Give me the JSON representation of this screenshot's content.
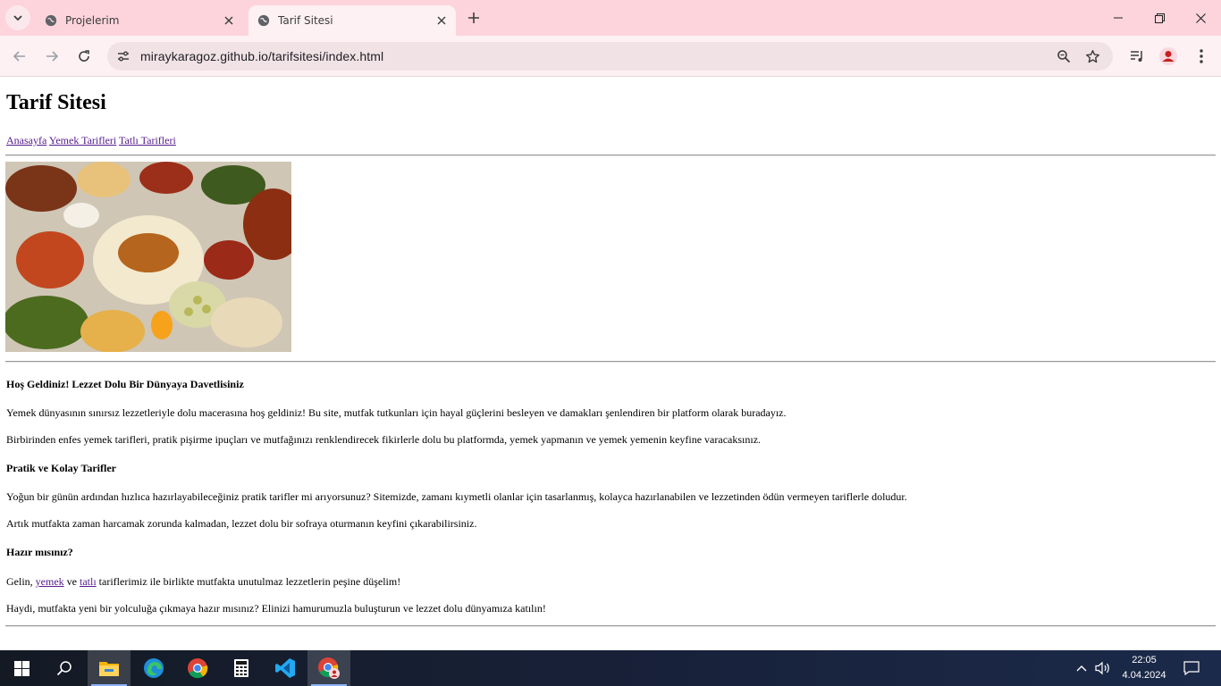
{
  "browser": {
    "tabs": [
      {
        "title": "Projelerim",
        "active": false
      },
      {
        "title": "Tarif Sitesi",
        "active": true
      }
    ],
    "url": "miraykaragoz.github.io/tarifsitesi/index.html"
  },
  "page": {
    "title": "Tarif Sitesi",
    "nav": [
      "Anasayfa",
      "Yemek Tarifleri",
      "Tatlı Tarifleri"
    ],
    "image_alt": "food-spread-image",
    "sections": {
      "welcome_heading": "Hoş Geldiniz! Lezzet Dolu Bir Dünyaya Davetlisiniz",
      "welcome_p1": "Yemek dünyasının sınırsız lezzetleriyle dolu macerasına hoş geldiniz! Bu site, mutfak tutkunları için hayal güçlerini besleyen ve damakları şenlendiren bir platform olarak buradayız.",
      "welcome_p2": "Birbirinden enfes yemek tarifleri, pratik pişirme ipuçları ve mutfağınızı renklendirecek fikirlerle dolu bu platformda, yemek yapmanın ve yemek yemenin keyfine varacaksınız.",
      "practical_heading": "Pratik ve Kolay Tarifler",
      "practical_p1": "Yoğun bir günün ardından hızlıca hazırlayabileceğiniz pratik tarifler mi arıyorsunuz? Sitemizde, zamanı kıymetli olanlar için tasarlanmış, kolayca hazırlanabilen ve lezzetinden ödün vermeyen tariflerle doludur.",
      "practical_p2": "Artık mutfakta zaman harcamak zorunda kalmadan, lezzet dolu bir sofraya oturmanın keyfini çıkarabilirsiniz.",
      "ready_heading": "Hazır mısınız?",
      "ready_p1_pre": "Gelin, ",
      "ready_p1_link1": "yemek",
      "ready_p1_mid": " ve ",
      "ready_p1_link2": "tatlı",
      "ready_p1_post": " tariflerimiz ile birlikte mutfakta unutulmaz lezzetlerin peşine düşelim!",
      "ready_p2": "Haydi, mutfakta yeni bir yolculuğa çıkmaya hazır mısınız? Elinizi hamurumuzla buluşturun ve lezzet dolu dünyamıza katılın!"
    },
    "link_color": "#551a8b"
  },
  "taskbar": {
    "apps": [
      "start",
      "search",
      "file-explorer",
      "edge",
      "chrome",
      "calculator",
      "vscode",
      "chrome-profile"
    ],
    "time": "22:05",
    "date": "4.04.2024"
  }
}
